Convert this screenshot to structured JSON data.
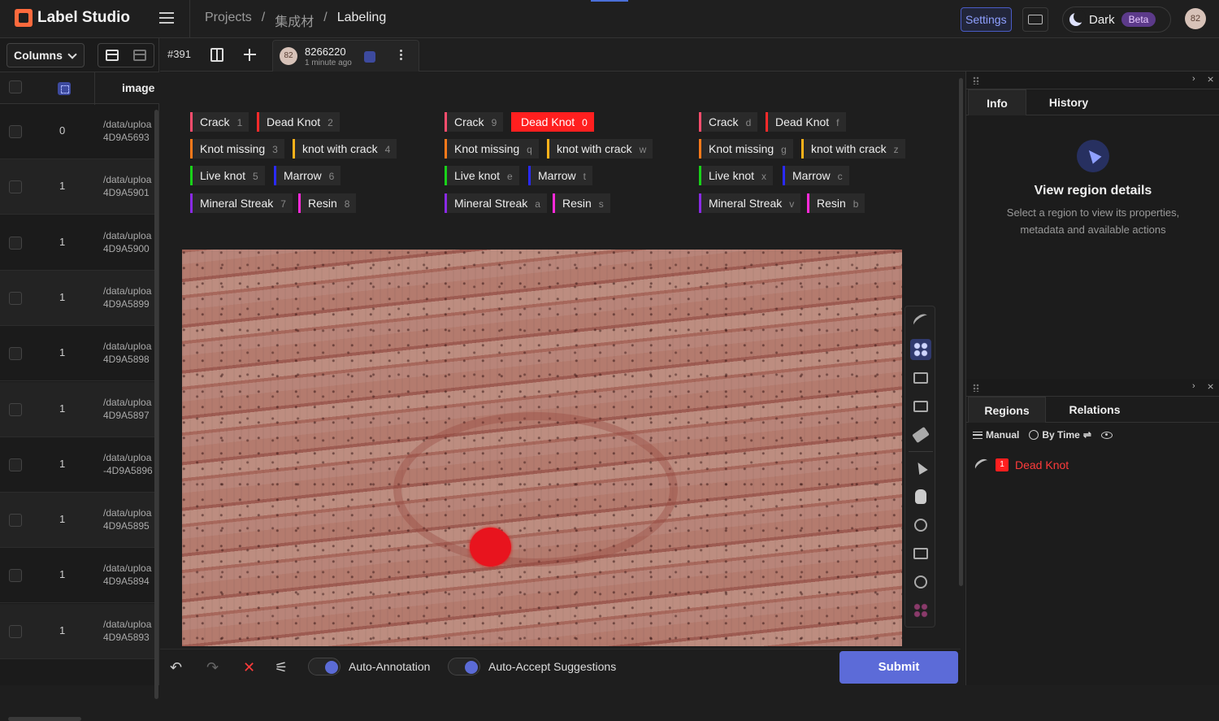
{
  "app": {
    "name": "Label Studio"
  },
  "breadcrumb": {
    "root": "Projects",
    "sep": "/",
    "project": "集成材",
    "current": "Labeling"
  },
  "header": {
    "settings_label": "Settings",
    "theme_label": "Dark",
    "beta_label": "Beta",
    "user_initials": "82"
  },
  "left_panel": {
    "columns_label": "Columns",
    "column_image": "image",
    "rows": [
      {
        "num": "0",
        "path1": "/data/uploa",
        "path2": "4D9A5693"
      },
      {
        "num": "1",
        "path1": "/data/uploa",
        "path2": "4D9A5901"
      },
      {
        "num": "1",
        "path1": "/data/uploa",
        "path2": "4D9A5900"
      },
      {
        "num": "1",
        "path1": "/data/uploa",
        "path2": "4D9A5899"
      },
      {
        "num": "1",
        "path1": "/data/uploa",
        "path2": "4D9A5898"
      },
      {
        "num": "1",
        "path1": "/data/uploa",
        "path2": "4D9A5897"
      },
      {
        "num": "1",
        "path1": "/data/uploa",
        "path2": "-4D9A5896"
      },
      {
        "num": "1",
        "path1": "/data/uploa",
        "path2": "4D9A5895"
      },
      {
        "num": "1",
        "path1": "/data/uploa",
        "path2": "4D9A5894"
      },
      {
        "num": "1",
        "path1": "/data/uploa",
        "path2": "4D9A5893"
      }
    ]
  },
  "task": {
    "id": "#391",
    "annotation_id": "8266220",
    "annotation_time": "1 minute ago",
    "annotator_initials": "82"
  },
  "label_groups": [
    {
      "labels": [
        {
          "name": "Crack",
          "hotkey": "1",
          "color": "#ff4d6d"
        },
        {
          "name": "Dead Knot",
          "hotkey": "2",
          "color": "#ff2a2a"
        },
        {
          "name": "Knot missing",
          "hotkey": "3",
          "color": "#ff7a1a"
        },
        {
          "name": "knot with crack",
          "hotkey": "4",
          "color": "#ffb21a"
        },
        {
          "name": "Live knot",
          "hotkey": "5",
          "color": "#19d219"
        },
        {
          "name": "Marrow",
          "hotkey": "6",
          "color": "#2a2aff"
        },
        {
          "name": "Mineral Streak",
          "hotkey": "7",
          "color": "#8a2ae6"
        },
        {
          "name": "Resin",
          "hotkey": "8",
          "color": "#ff2ad9"
        }
      ]
    },
    {
      "labels": [
        {
          "name": "Crack",
          "hotkey": "9",
          "color": "#ff4d6d"
        },
        {
          "name": "Dead Knot",
          "hotkey": "0",
          "color": "#ff2a2a",
          "selected": true
        },
        {
          "name": "Knot missing",
          "hotkey": "q",
          "color": "#ff7a1a"
        },
        {
          "name": "knot with crack",
          "hotkey": "w",
          "color": "#ffb21a"
        },
        {
          "name": "Live knot",
          "hotkey": "e",
          "color": "#19d219"
        },
        {
          "name": "Marrow",
          "hotkey": "t",
          "color": "#2a2aff"
        },
        {
          "name": "Mineral Streak",
          "hotkey": "a",
          "color": "#8a2ae6"
        },
        {
          "name": "Resin",
          "hotkey": "s",
          "color": "#ff2ad9"
        }
      ]
    },
    {
      "labels": [
        {
          "name": "Crack",
          "hotkey": "d",
          "color": "#ff4d6d"
        },
        {
          "name": "Dead Knot",
          "hotkey": "f",
          "color": "#ff2a2a"
        },
        {
          "name": "Knot missing",
          "hotkey": "g",
          "color": "#ff7a1a"
        },
        {
          "name": "knot with crack",
          "hotkey": "z",
          "color": "#ffb21a"
        },
        {
          "name": "Live knot",
          "hotkey": "x",
          "color": "#19d219"
        },
        {
          "name": "Marrow",
          "hotkey": "c",
          "color": "#2a2aff"
        },
        {
          "name": "Mineral Streak",
          "hotkey": "v",
          "color": "#8a2ae6"
        },
        {
          "name": "Resin",
          "hotkey": "b",
          "color": "#ff2ad9"
        }
      ]
    }
  ],
  "bottom_bar": {
    "auto_annotation_label": "Auto-Annotation",
    "auto_accept_label": "Auto-Accept Suggestions",
    "submit_label": "Submit"
  },
  "right_panel": {
    "tab_info": "Info",
    "tab_history": "History",
    "info_title": "View region details",
    "info_desc": "Select a region to view its properties, metadata and available actions",
    "tab_regions": "Regions",
    "tab_relations": "Relations",
    "sort_manual": "Manual",
    "sort_by_time": "By Time",
    "region": {
      "index": "1",
      "label": "Dead Knot"
    }
  }
}
